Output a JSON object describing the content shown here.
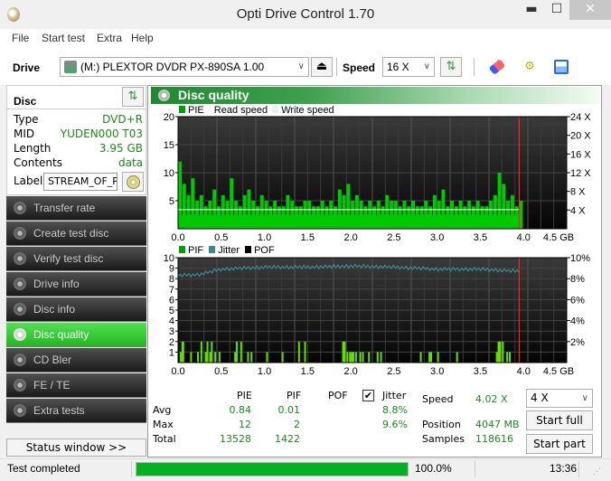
{
  "window": {
    "title": "Opti Drive Control 1.70",
    "min": "▬",
    "max": "☐",
    "close": "✕"
  },
  "menu": [
    "File",
    "Start test",
    "Extra",
    "Help"
  ],
  "toolbar": {
    "drive_label": "Drive",
    "drive_value": "(M:)  PLEXTOR DVDR   PX-890SA 1.00",
    "speed_label": "Speed",
    "speed_value": "16 X"
  },
  "disc": {
    "title": "Disc",
    "rows": [
      {
        "key": "Type",
        "value": "DVD+R"
      },
      {
        "key": "MID",
        "value": "YUDEN000 T03"
      },
      {
        "key": "Length",
        "value": "3.95 GB"
      },
      {
        "key": "Contents",
        "value": "data"
      }
    ],
    "label_key": "Label",
    "label_value": "STREAM_OF_P"
  },
  "nav": [
    {
      "label": "Transfer rate",
      "active": false
    },
    {
      "label": "Create test disc",
      "active": false
    },
    {
      "label": "Verify test disc",
      "active": false
    },
    {
      "label": "Drive info",
      "active": false
    },
    {
      "label": "Disc info",
      "active": false
    },
    {
      "label": "Disc quality",
      "active": true
    },
    {
      "label": "CD Bler",
      "active": false
    },
    {
      "label": "FE / TE",
      "active": false
    },
    {
      "label": "Extra tests",
      "active": false
    }
  ],
  "status_window_btn": "Status window >>",
  "panel": {
    "title": "Disc quality"
  },
  "legend_top": {
    "pie": "PIE",
    "read": "Read speed",
    "write": "Write speed"
  },
  "legend_bottom": {
    "pif": "PIF",
    "jitter": "Jitter",
    "pof": "POF"
  },
  "colors": {
    "pie": "#00c800",
    "pif": "#66dd00",
    "jitter": "#3a9a9a",
    "read": "#ffffff",
    "marker": "#ff2020",
    "accent": "#1a8a1a"
  },
  "chart_data": [
    {
      "type": "bar",
      "title": "PIE / Read speed",
      "xlabel": "GB",
      "x_ticks": [
        "0.0",
        "0.5",
        "1.0",
        "1.5",
        "2.0",
        "2.5",
        "3.0",
        "3.5",
        "4.0",
        "4.5 GB"
      ],
      "xlim": [
        0,
        4.5
      ],
      "ylim": [
        0,
        20
      ],
      "y_ticks": [
        "5",
        "10",
        "15",
        "20"
      ],
      "y2_ticks": [
        "4 X",
        "8 X",
        "12 X",
        "16 X",
        "20 X",
        "24 X"
      ],
      "y2lim": [
        0,
        24
      ],
      "disc_end": 3.95,
      "series": [
        {
          "name": "PIE",
          "x": [
            0.0,
            0.05,
            0.1,
            0.15,
            0.2,
            0.25,
            0.3,
            0.35,
            0.4,
            0.45,
            0.5,
            0.55,
            0.6,
            0.65,
            0.7,
            0.75,
            0.8,
            0.85,
            0.9,
            0.95,
            1.0,
            1.05,
            1.1,
            1.15,
            1.2,
            1.25,
            1.3,
            1.35,
            1.4,
            1.45,
            1.5,
            1.55,
            1.6,
            1.65,
            1.7,
            1.75,
            1.8,
            1.85,
            1.9,
            1.95,
            2.0,
            2.05,
            2.1,
            2.15,
            2.2,
            2.25,
            2.3,
            2.35,
            2.4,
            2.45,
            2.5,
            2.55,
            2.6,
            2.65,
            2.7,
            2.75,
            2.8,
            2.85,
            2.9,
            2.95,
            3.0,
            3.05,
            3.1,
            3.15,
            3.2,
            3.25,
            3.3,
            3.35,
            3.4,
            3.45,
            3.5,
            3.55,
            3.6,
            3.65,
            3.7,
            3.75,
            3.8,
            3.85,
            3.9,
            3.95
          ],
          "values": [
            12,
            8,
            6,
            9,
            5,
            6,
            4,
            5,
            7,
            4,
            6,
            5,
            9,
            5,
            4,
            6,
            7,
            5,
            4,
            6,
            5,
            4,
            5,
            4,
            4,
            6,
            5,
            4,
            4,
            5,
            5,
            4,
            4,
            5,
            4,
            5,
            4,
            7,
            6,
            8,
            5,
            6,
            5,
            4,
            5,
            4,
            5,
            4,
            6,
            5,
            5,
            4,
            5,
            4,
            5,
            4,
            4,
            5,
            4,
            6,
            5,
            7,
            4,
            5,
            4,
            5,
            4,
            5,
            4,
            5,
            4,
            4,
            5,
            6,
            10,
            8,
            5,
            6,
            4,
            5
          ]
        },
        {
          "name": "Read speed",
          "values_x": 4.0
        }
      ]
    },
    {
      "type": "bar",
      "title": "PIF / Jitter",
      "xlabel": "GB",
      "x_ticks": [
        "0.0",
        "0.5",
        "1.0",
        "1.5",
        "2.0",
        "2.5",
        "3.0",
        "3.5",
        "4.0",
        "4.5 GB"
      ],
      "xlim": [
        0,
        4.5
      ],
      "ylim": [
        0,
        10
      ],
      "y_ticks": [
        "1",
        "2",
        "3",
        "4",
        "5",
        "6",
        "7",
        "8",
        "9",
        "10"
      ],
      "y2_ticks": [
        "2%",
        "4%",
        "6%",
        "8%",
        "10%"
      ],
      "y2lim": [
        0,
        10
      ],
      "disc_end": 3.95,
      "series": [
        {
          "name": "PIF",
          "x": [
            0.02,
            0.04,
            0.05,
            0.14,
            0.22,
            0.26,
            0.31,
            0.33,
            0.36,
            0.38,
            0.42,
            0.47,
            0.65,
            0.67,
            0.72,
            0.8,
            0.84,
            1.02,
            1.2,
            1.39,
            1.46,
            1.9,
            1.92,
            1.95,
            1.98,
            2.0,
            2.02,
            2.05,
            2.1,
            2.13,
            2.2,
            2.3,
            2.34,
            2.8,
            2.9,
            2.92,
            3.0,
            3.22,
            3.68,
            3.7,
            3.72,
            3.75,
            3.8,
            3.83
          ],
          "values": [
            1,
            2,
            2,
            1,
            1,
            2,
            1,
            2,
            1,
            2,
            1,
            1,
            1,
            2,
            2,
            1,
            1,
            1,
            1,
            2,
            2,
            2,
            2,
            1,
            1,
            1,
            1,
            1,
            1,
            1,
            1,
            1,
            1,
            1,
            1,
            1,
            1,
            1,
            1,
            2,
            2,
            2,
            1,
            1
          ]
        },
        {
          "name": "Jitter",
          "x": [
            0.0,
            0.25,
            0.5,
            0.75,
            1.0,
            1.5,
            2.0,
            2.5,
            3.0,
            3.5,
            3.95
          ],
          "values": [
            8.3,
            8.4,
            8.9,
            9.0,
            9.1,
            9.1,
            9.2,
            9.1,
            8.9,
            8.9,
            8.7
          ]
        }
      ]
    }
  ],
  "stats": {
    "headers": [
      "PIE",
      "PIF",
      "POF",
      "Jitter"
    ],
    "jitter_checked": true,
    "rows": [
      {
        "label": "Avg",
        "pie": "0.84",
        "pif": "0.01",
        "pof": "",
        "jitter": "8.8%"
      },
      {
        "label": "Max",
        "pie": "12",
        "pif": "2",
        "pof": "",
        "jitter": "9.6%"
      },
      {
        "label": "Total",
        "pie": "13528",
        "pif": "1422",
        "pof": "",
        "jitter": ""
      }
    ],
    "speed_label": "Speed",
    "speed_value": "4.02 X",
    "position_label": "Position",
    "position_value": "4047 MB",
    "samples_label": "Samples",
    "samples_value": "118616",
    "speed_select": "4 X",
    "start_full": "Start full",
    "start_part": "Start part"
  },
  "statusbar": {
    "text": "Test completed",
    "progress": 100.0,
    "progress_text": "100.0%",
    "time": "13:36"
  }
}
